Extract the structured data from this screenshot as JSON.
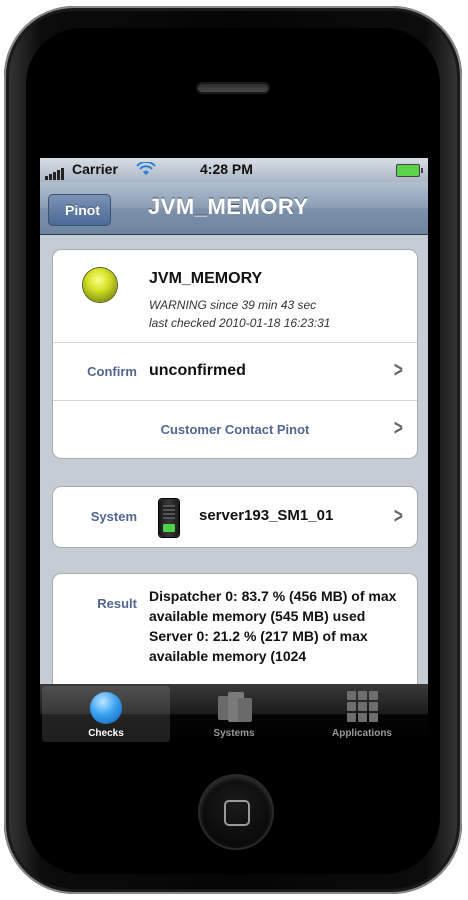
{
  "status_bar": {
    "carrier": "Carrier",
    "time": "4:28 PM"
  },
  "nav": {
    "back_label": "Pinot",
    "title": "JVM_MEMORY"
  },
  "check": {
    "name": "JVM_MEMORY",
    "state_line": "WARNING since 39 min 43 sec",
    "checked_line": "last checked 2010-01-18 16:23:31",
    "status_color": "#d8e42a"
  },
  "confirm": {
    "label": "Confirm",
    "value": "unconfirmed"
  },
  "contact": {
    "label": "Customer Contact Pinot"
  },
  "system": {
    "label": "System",
    "value": "server193_SM1_01"
  },
  "result": {
    "label": "Result",
    "text": "Dispatcher 0: 83.7 % (456 MB) of max available memory (545 MB) used\nServer 0: 21.2 % (217 MB) of max available memory (1024"
  },
  "tabs": [
    {
      "label": "Checks",
      "icon": "checks-icon",
      "active": true
    },
    {
      "label": "Systems",
      "icon": "systems-icon",
      "active": false
    },
    {
      "label": "Applications",
      "icon": "applications-icon",
      "active": false
    }
  ]
}
